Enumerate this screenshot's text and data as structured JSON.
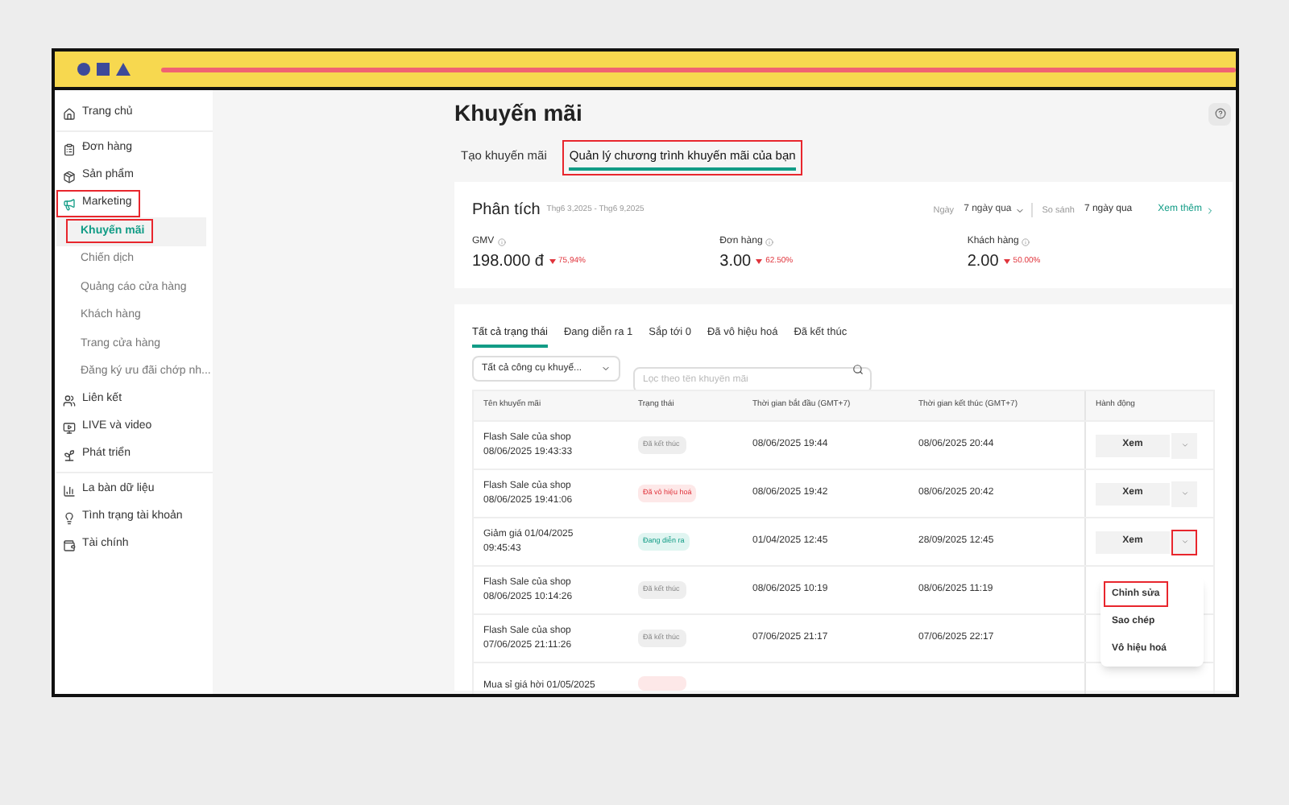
{
  "sidebar": {
    "groups": [
      {
        "items": [
          {
            "label": "Trang chủ",
            "selected": false,
            "highlighted": false
          }
        ]
      },
      {
        "items": [
          {
            "label": "Đơn hàng",
            "selected": false,
            "highlighted": false
          },
          {
            "label": "Sản phẩm",
            "selected": false,
            "highlighted": false
          },
          {
            "label": "Marketing",
            "selected": false,
            "highlighted": true,
            "children": [
              {
                "label": "Khuyến mãi",
                "selected": true,
                "highlighted": true
              },
              {
                "label": "Chiến dịch",
                "selected": false,
                "highlighted": false
              },
              {
                "label": "Quảng cáo cửa hàng",
                "selected": false,
                "highlighted": false
              },
              {
                "label": "Khách hàng",
                "selected": false,
                "highlighted": false
              },
              {
                "label": "Trang cửa hàng",
                "selected": false,
                "highlighted": false
              },
              {
                "label": "Đăng ký ưu đãi chớp nh...",
                "selected": false,
                "highlighted": false
              }
            ]
          },
          {
            "label": "Liên kết",
            "selected": false,
            "highlighted": false
          },
          {
            "label": "LIVE và video",
            "selected": false,
            "highlighted": false
          },
          {
            "label": "Phát triển",
            "selected": false,
            "highlighted": false
          }
        ]
      },
      {
        "items": [
          {
            "label": "La bàn dữ liệu",
            "selected": false,
            "highlighted": false
          },
          {
            "label": "Tình trạng tài khoản",
            "selected": false,
            "highlighted": false
          },
          {
            "label": "Tài chính",
            "selected": false,
            "highlighted": false
          }
        ]
      }
    ]
  },
  "page": {
    "title": "Khuyến mãi",
    "tabs": [
      {
        "label": "Tạo khuyến mãi",
        "selected": false,
        "highlighted": false
      },
      {
        "label": "Quản lý chương trình khuyến mãi của bạn",
        "selected": true,
        "highlighted": true
      }
    ],
    "analytics": {
      "title": "Phân tích",
      "range": "Thg6 3,2025 - Thg6 9,2025",
      "period_label": "Ngày",
      "period": "7 ngày qua",
      "compare_label": "So sánh",
      "compare": "7 ngày qua",
      "more": "Xem thêm",
      "metrics": [
        {
          "label": "GMV",
          "value": "198.000 đ",
          "change": "75,94%"
        },
        {
          "label": "Đơn hàng",
          "value": "3.00",
          "change": "62.50%"
        },
        {
          "label": "Khách hàng",
          "value": "2.00",
          "change": "50.00%"
        }
      ]
    },
    "status_tabs": [
      {
        "label": "Tất cả trạng thái",
        "selected": true
      },
      {
        "label": "Đang diễn ra",
        "count": "1",
        "selected": false
      },
      {
        "label": "Sắp tới",
        "count": "0",
        "selected": false
      },
      {
        "label": "Đã vô hiệu hoá",
        "selected": false
      },
      {
        "label": "Đã kết thúc",
        "selected": false
      }
    ],
    "tool_filter": "Tất cả công cụ khuyế...",
    "search": {
      "placeholder": "Lọc theo tên khuyến mãi"
    },
    "table": {
      "columns": [
        "Tên khuyến mãi",
        "Trạng thái",
        "Thời gian bắt đầu (GMT+7)",
        "Thời gian kết thúc (GMT+7)",
        "Hành động"
      ],
      "rows": [
        {
          "name": "Flash Sale của shop",
          "created": "08/06/2025 19:43:33",
          "status": {
            "kind": "ended",
            "label": "Đã kết thúc"
          },
          "start": "08/06/2025 19:44",
          "end": "08/06/2025 20:44",
          "action": "Xem",
          "menu_highlighted": false
        },
        {
          "name": "Flash Sale của shop",
          "created": "08/06/2025 19:41:06",
          "status": {
            "kind": "disabled",
            "label": "Đã vô hiệu hoá"
          },
          "start": "08/06/2025 19:42",
          "end": "08/06/2025 20:42",
          "action": "Xem",
          "menu_highlighted": false
        },
        {
          "name": "Giảm giá 01/04/2025",
          "created": "09:45:43",
          "status": {
            "kind": "active",
            "label": "Đang diễn ra"
          },
          "start": "01/04/2025 12:45",
          "end": "28/09/2025 12:45",
          "action": "Xem",
          "menu_highlighted": true,
          "menu": [
            {
              "label": "Chỉnh sửa",
              "highlighted": true
            },
            {
              "label": "Sao chép",
              "highlighted": false
            },
            {
              "label": "Vô hiệu hoá",
              "highlighted": false
            }
          ]
        },
        {
          "name": "Flash Sale của shop",
          "created": "08/06/2025 10:14:26",
          "status": {
            "kind": "ended",
            "label": "Đã kết thúc"
          },
          "start": "08/06/2025 10:19",
          "end": "08/06/2025 11:19"
        },
        {
          "name": "Flash Sale của shop",
          "created": "07/06/2025 21:11:26",
          "status": {
            "kind": "ended",
            "label": "Đã kết thúc"
          },
          "start": "07/06/2025 21:17",
          "end": "07/06/2025 22:17"
        },
        {
          "name": "Mua sỉ giá hời 01/05/2025",
          "status": {
            "kind": "disabled"
          }
        }
      ]
    }
  }
}
